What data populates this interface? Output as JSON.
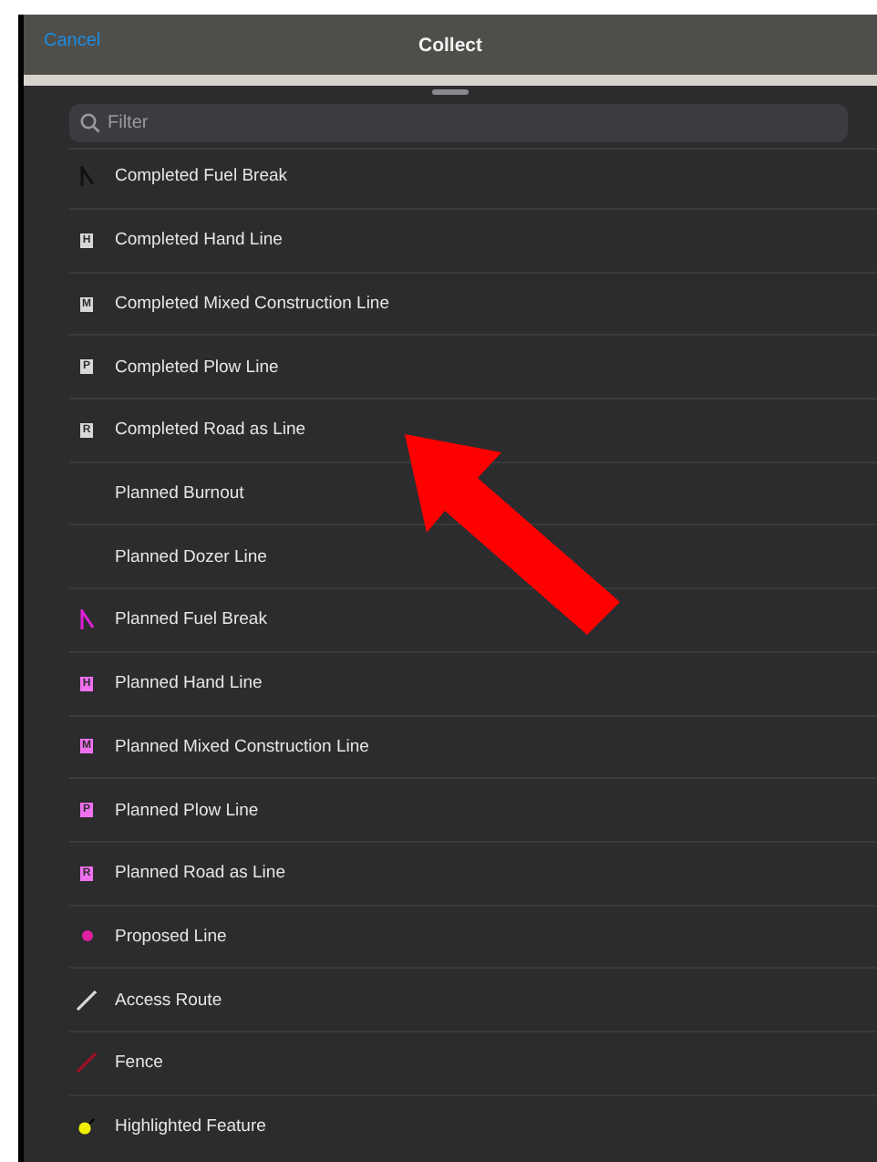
{
  "nav_bar": {
    "cancel": "Cancel",
    "title": "Collect"
  },
  "filter": {
    "placeholder": "Filter"
  },
  "items": [
    {
      "label": "Completed Fuel Break",
      "kind": "fuel-break",
      "color": "#111111"
    },
    {
      "label": "Completed Hand Line",
      "kind": "letter",
      "letter": "H",
      "color": "#d8d8d8"
    },
    {
      "label": "Completed Mixed Construction Line",
      "kind": "letter",
      "letter": "M",
      "color": "#d8d8d8"
    },
    {
      "label": "Completed Plow Line",
      "kind": "letter",
      "letter": "P",
      "color": "#d8d8d8"
    },
    {
      "label": "Completed Road as Line",
      "kind": "letter",
      "letter": "R",
      "color": "#d8d8d8"
    },
    {
      "label": "Planned Burnout",
      "kind": "none"
    },
    {
      "label": "Planned Dozer Line",
      "kind": "none"
    },
    {
      "label": "Planned Fuel Break",
      "kind": "fuel-break",
      "color": "#e020d8"
    },
    {
      "label": "Planned Hand Line",
      "kind": "letter",
      "letter": "H",
      "color": "#f070f0"
    },
    {
      "label": "Planned Mixed Construction Line",
      "kind": "letter",
      "letter": "M",
      "color": "#f070f0"
    },
    {
      "label": "Planned Plow Line",
      "kind": "letter",
      "letter": "P",
      "color": "#f070f0"
    },
    {
      "label": "Planned Road as Line",
      "kind": "letter",
      "letter": "R",
      "color": "#f070f0"
    },
    {
      "label": "Proposed Line",
      "kind": "dot",
      "color": "#e020a0"
    },
    {
      "label": "Access Route",
      "kind": "line",
      "color": "#d8d8d8"
    },
    {
      "label": "Fence",
      "kind": "line",
      "color": "#a01020"
    },
    {
      "label": "Highlighted Feature",
      "kind": "pin",
      "color": "#f0f000"
    }
  ]
}
